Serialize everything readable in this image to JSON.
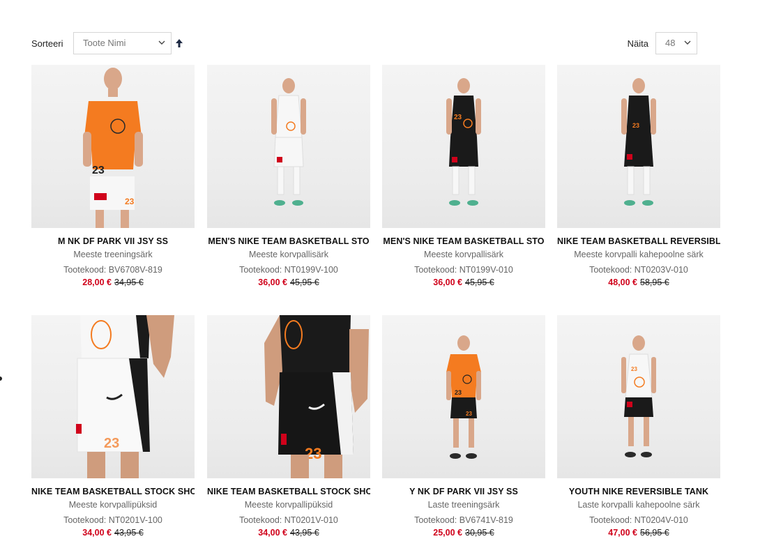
{
  "toolbar": {
    "sort_label": "Sorteeri",
    "sort_value": "Toote Nimi",
    "sort_direction_icon": "arrow-up-icon",
    "show_label": "Näita",
    "show_value": "48"
  },
  "products": [
    {
      "name": "M NK DF PARK VII JSY SS",
      "subtitle": "Meeste treeningsärk",
      "code": "Tootekood: BV6708V-819",
      "price": "28,00 €",
      "old_price": "34,95 €",
      "image": "adult-orange-jersey-photo"
    },
    {
      "name": "MEN'S NIKE TEAM BASKETBALL STO",
      "subtitle": "Meeste korvpallisärk",
      "code": "Tootekood: NT0199V-100",
      "price": "36,00 €",
      "old_price": "45,95 €",
      "image": "adult-white-basketball-kit-photo"
    },
    {
      "name": "MEN'S NIKE TEAM BASKETBALL STO",
      "subtitle": "Meeste korvpallisärk",
      "code": "Tootekood: NT0199V-010",
      "price": "36,00 €",
      "old_price": "45,95 €",
      "image": "adult-black-basketball-kit-photo"
    },
    {
      "name": "NIKE TEAM BASKETBALL REVERSIBL",
      "subtitle": "Meeste korvpalli kahepoolne särk",
      "code": "Tootekood: NT0203V-010",
      "price": "48,00 €",
      "old_price": "58,95 €",
      "image": "adult-reversible-black-tank-photo"
    },
    {
      "name": "NIKE TEAM BASKETBALL STOCK SHO",
      "subtitle": "Meeste korvpallipüksid",
      "code": "Tootekood: NT0201V-100",
      "price": "34,00 €",
      "old_price": "43,95 €",
      "image": "white-shorts-closeup-photo"
    },
    {
      "name": "NIKE TEAM BASKETBALL STOCK SHO",
      "subtitle": "Meeste korvpallipüksid",
      "code": "Tootekood: NT0201V-010",
      "price": "34,00 €",
      "old_price": "43,95 €",
      "image": "black-shorts-closeup-photo"
    },
    {
      "name": "Y NK DF PARK VII JSY SS",
      "subtitle": "Laste treeningsärk",
      "code": "Tootekood: BV6741V-819",
      "price": "25,00 €",
      "old_price": "30,95 €",
      "image": "youth-orange-jersey-photo"
    },
    {
      "name": "YOUTH NIKE REVERSIBLE TANK",
      "subtitle": "Laste korvpalli kahepoolne särk",
      "code": "Tootekood: NT0204V-010",
      "price": "47,00 €",
      "old_price": "56,95 €",
      "image": "youth-white-tank-photo"
    }
  ],
  "colors": {
    "sale_price": "#d0021b",
    "team_orange": "#f47b20",
    "kit_black": "#1a1a1a",
    "kit_white": "#f7f7f7"
  }
}
